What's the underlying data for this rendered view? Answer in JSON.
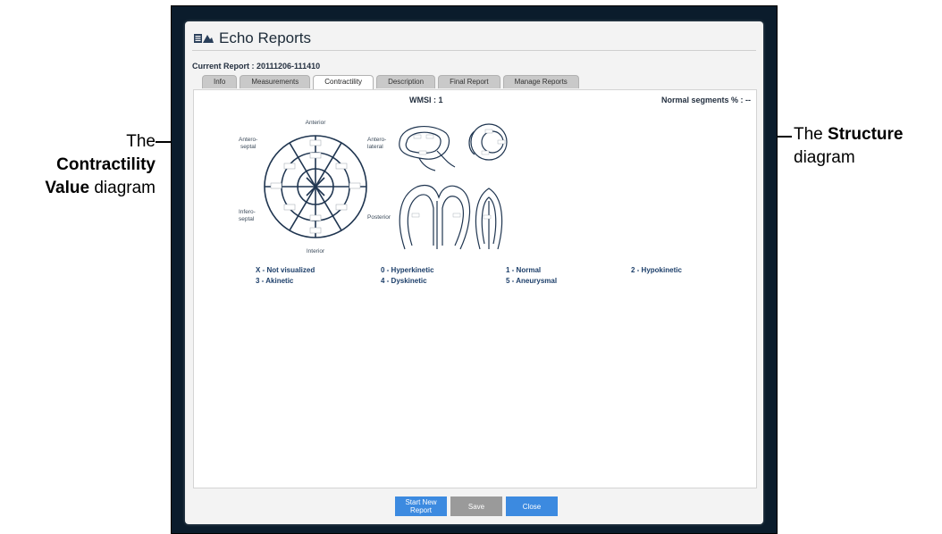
{
  "window": {
    "title": "Echo Reports",
    "current_report": "Current Report : 20111206-111410"
  },
  "tabs": [
    {
      "label": "Info",
      "active": false
    },
    {
      "label": "Measurements",
      "active": false
    },
    {
      "label": "Contractility",
      "active": true
    },
    {
      "label": "Description",
      "active": false
    },
    {
      "label": "Final Report",
      "active": false
    },
    {
      "label": "Manage Reports",
      "active": false
    }
  ],
  "contractility": {
    "wmsi": "WMSI : 1",
    "normal_segments": "Normal segments % : --",
    "bullseye_labels": {
      "anterior": "Anterior",
      "antero_septal_1": "Antero-",
      "antero_septal_2": "septal",
      "antero_lateral_1": "Antero-",
      "antero_lateral_2": "lateral",
      "infero_septal_1": "Infero-",
      "infero_septal_2": "septal",
      "posterior": "Posterior",
      "interior": "Interior"
    },
    "legend": [
      "X - Not visualized",
      "0 - Hyperkinetic",
      "1 - Normal",
      "2 - Hypokinetic",
      "3 - Akinetic",
      "4 - Dyskinetic",
      "5 - Aneurysmal"
    ]
  },
  "buttons": {
    "start_new_1": "Start New",
    "start_new_2": "Report",
    "save": "Save",
    "close": "Close"
  },
  "callouts": {
    "left_1": "The",
    "left_2": "Contractility",
    "left_3_bold": "Value",
    "left_3_rest": " diagram",
    "right_1": "The ",
    "right_1_bold": "Structure",
    "right_2": "diagram"
  },
  "colors": {
    "button_blue": "#3c8ae0",
    "button_gray": "#9a9a9a",
    "frame": "#0b1c2c"
  }
}
